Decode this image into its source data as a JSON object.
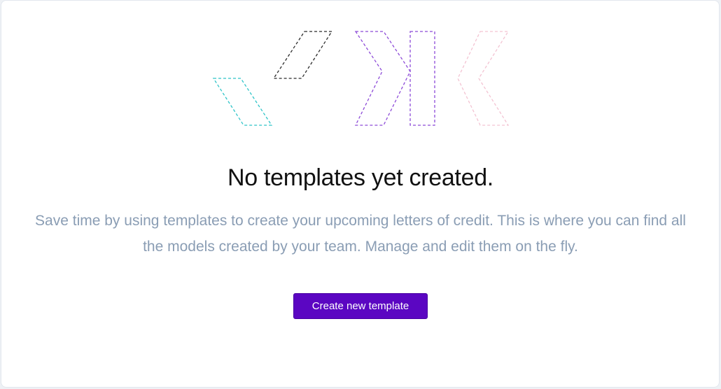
{
  "empty_state": {
    "title": "No templates yet created.",
    "description": "Save time by using templates to create your upcoming letters of credit. This is where you can find all the models created by your team. Manage and edit them on the fly.",
    "cta_label": "Create new template"
  },
  "colors": {
    "cta_background": "#5b06c2",
    "title": "#111111",
    "description": "#8a9db4",
    "illustration_teal": "#2ec4c8",
    "illustration_dark": "#2b2b2b",
    "illustration_purple": "#8d4bd8",
    "illustration_pink": "#f3c3d2"
  },
  "icons": {
    "illustration": "dashed-outline-logo-shapes-icon"
  }
}
